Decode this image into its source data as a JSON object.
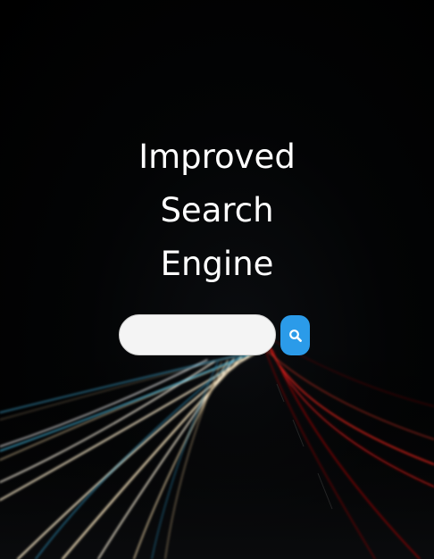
{
  "title": {
    "line1": "Improved",
    "line2": "Search",
    "line3": "Engine"
  },
  "search": {
    "value": "",
    "placeholder": "",
    "button_icon": "search-icon"
  },
  "colors": {
    "background": "#000000",
    "title_text": "#ffffff",
    "search_field": "#f4f4f4",
    "search_button": "#2b9be9",
    "light_trail_warm": "#f3e3c2",
    "light_trail_cool": "#48c0e8",
    "light_trail_red": "#e0201c"
  },
  "background": {
    "description_icon": "highway-light-trails-photo"
  }
}
